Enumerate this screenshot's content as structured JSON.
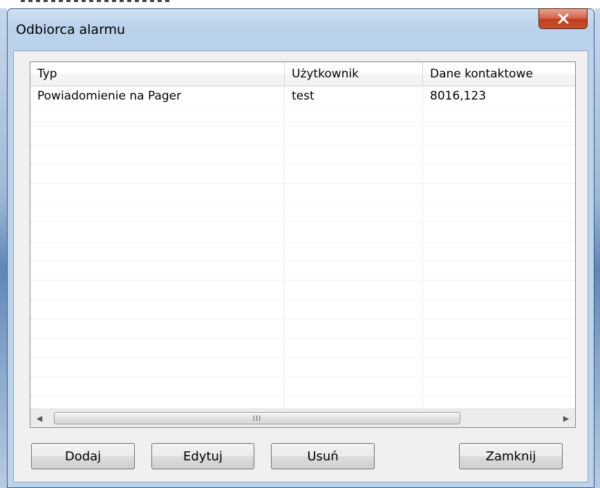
{
  "window": {
    "title": "Odbiorca alarmu"
  },
  "close": {
    "icon": "close-x-icon",
    "color": "#c9502f"
  },
  "list": {
    "columns": [
      "Typ",
      "Użytkownik",
      "Dane kontaktowe"
    ],
    "rows": [
      {
        "type": "Powiadomienie na Pager",
        "user": "test",
        "contact": "8016,123"
      }
    ]
  },
  "scrollbar": {
    "left_icon": "scroll-left-arrow-icon",
    "right_icon": "scroll-right-arrow-icon",
    "grip_icon": "grip-icon"
  },
  "buttons": {
    "add": "Dodaj",
    "edit": "Edytuj",
    "delete": "Usuń",
    "close": "Zamknij"
  }
}
